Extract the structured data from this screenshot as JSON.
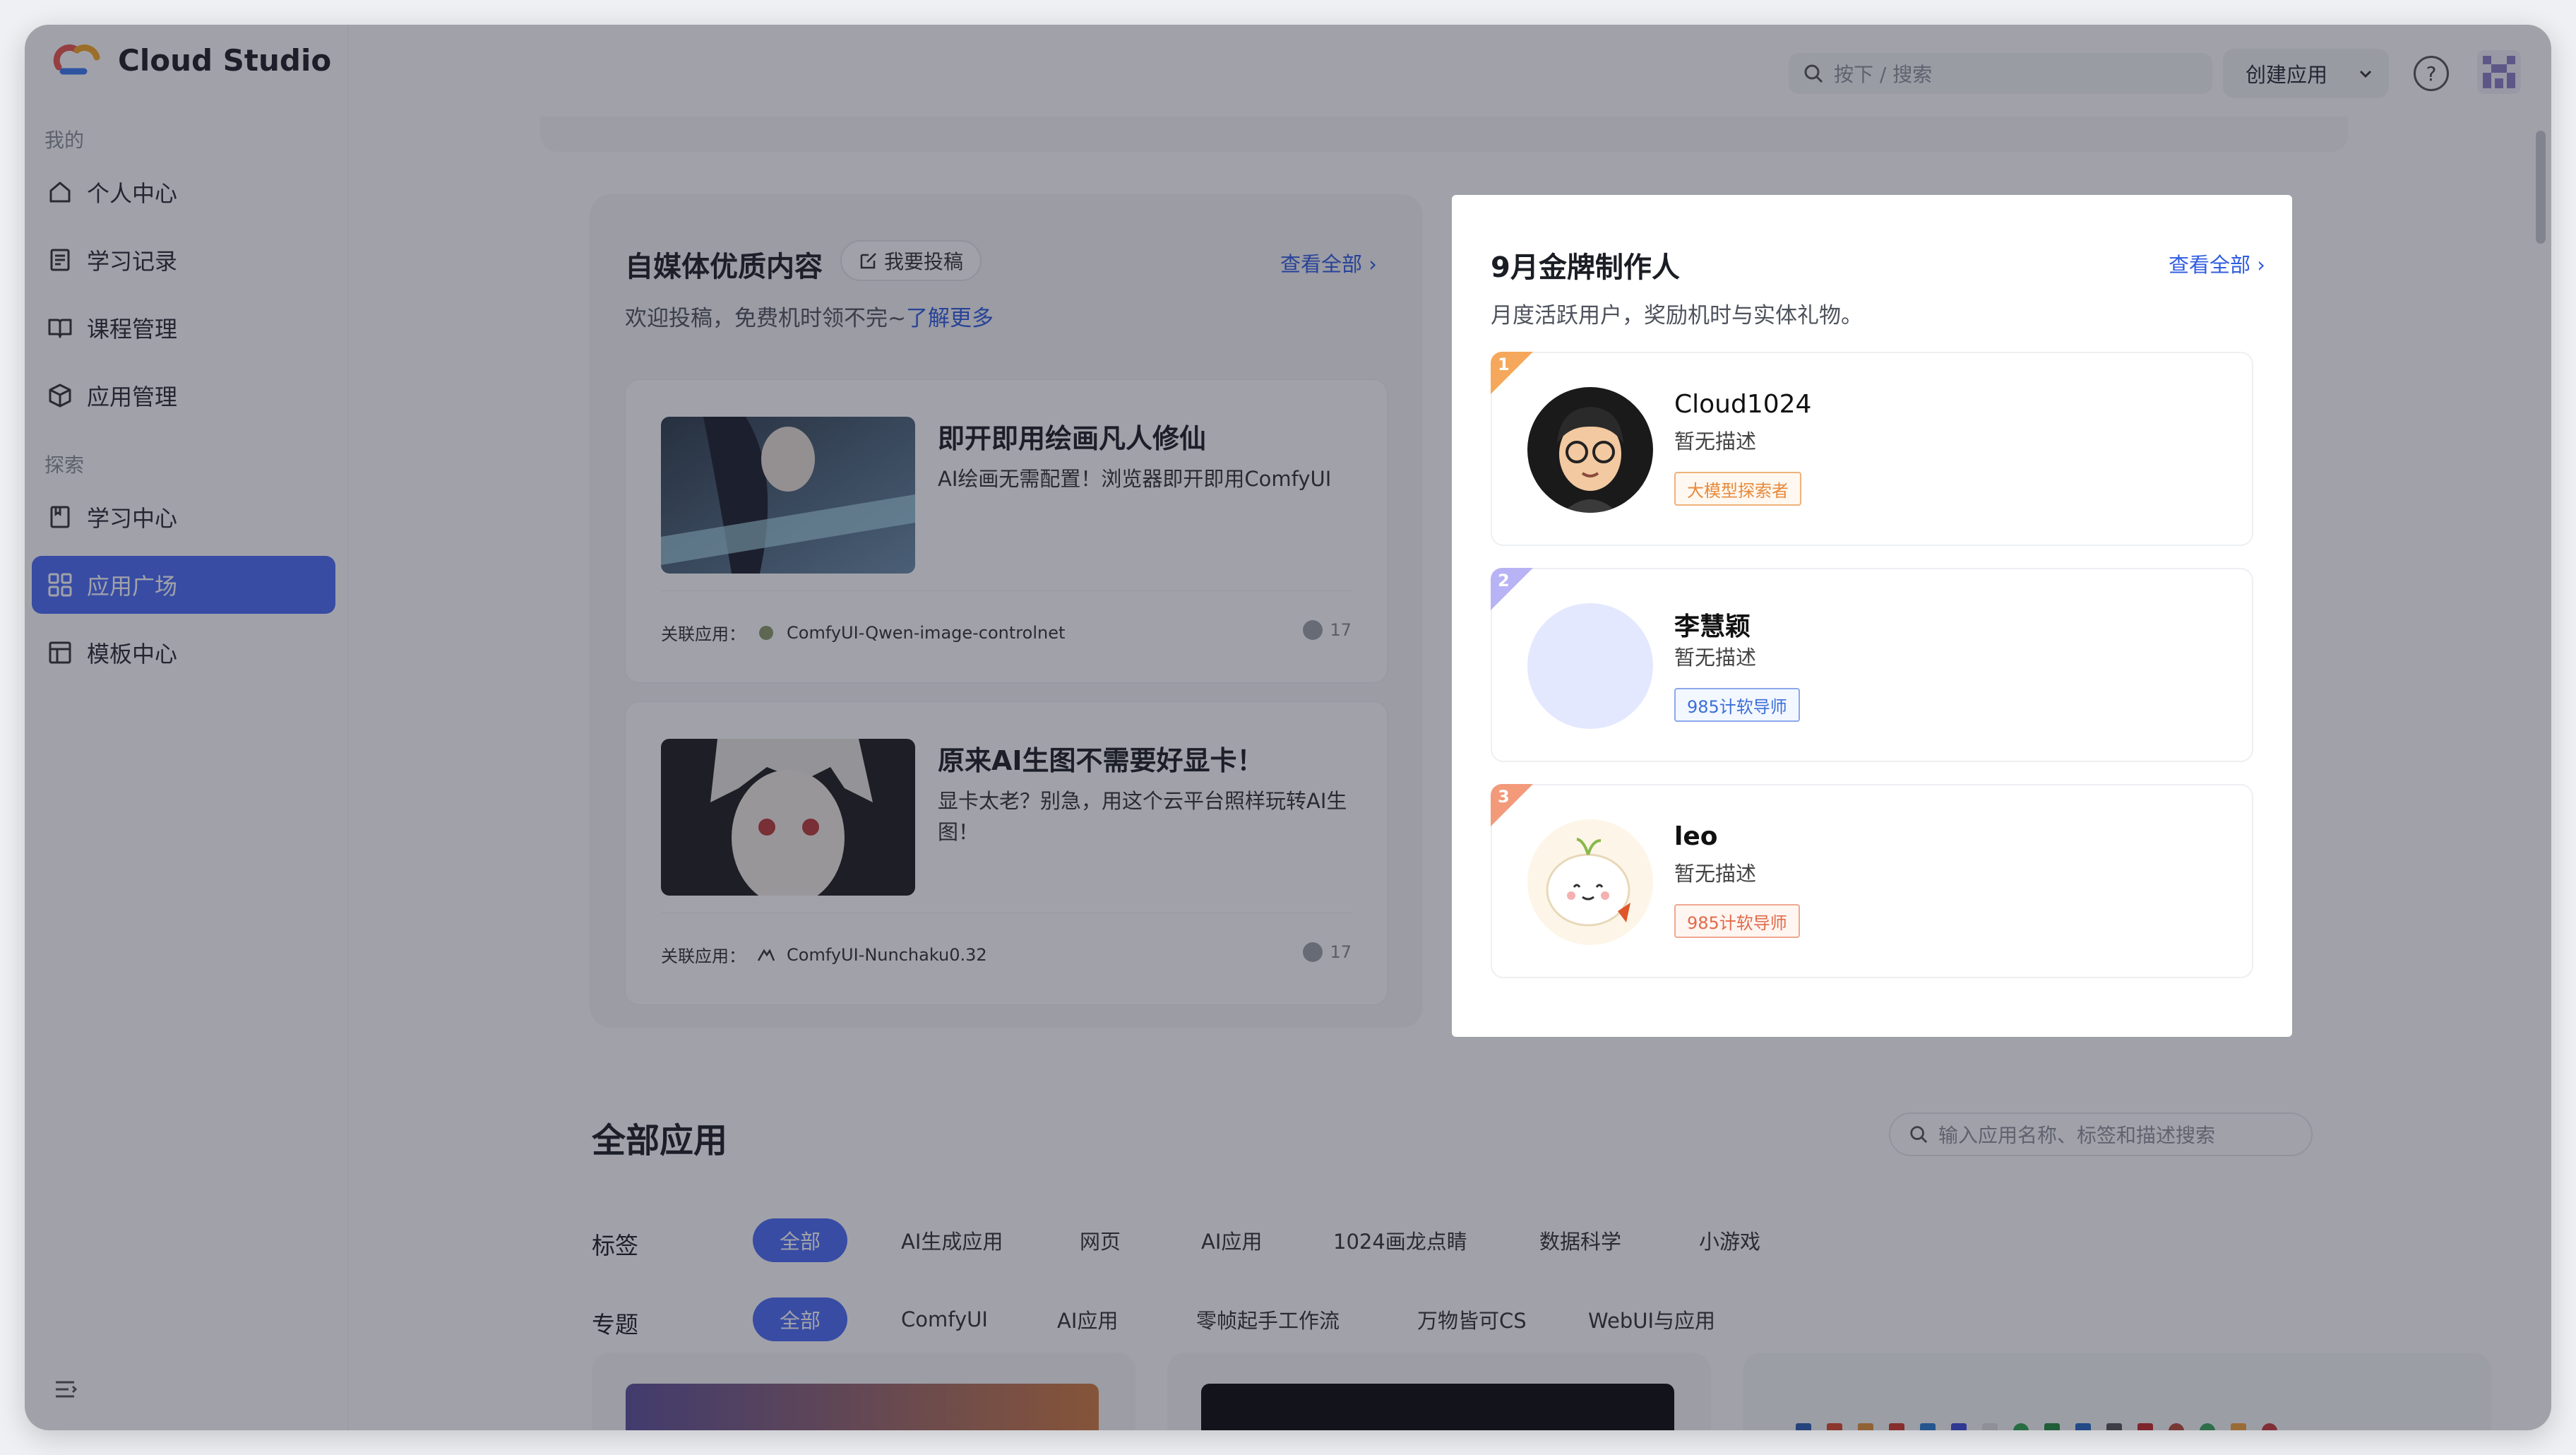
{
  "app": {
    "name": "Cloud Studio"
  },
  "sidebar": {
    "section_mine": "我的",
    "section_explore": "探索",
    "items": [
      {
        "label": "个人中心",
        "icon": "home-icon"
      },
      {
        "label": "学习记录",
        "icon": "record-icon"
      },
      {
        "label": "课程管理",
        "icon": "book-icon"
      },
      {
        "label": "应用管理",
        "icon": "cube-icon"
      },
      {
        "label": "学习中心",
        "icon": "notebook-icon"
      },
      {
        "label": "应用广场",
        "icon": "grid-icon",
        "active": true
      },
      {
        "label": "模板中心",
        "icon": "template-icon"
      }
    ]
  },
  "header": {
    "search_placeholder": "按下 /  搜索",
    "create_label": "创建应用"
  },
  "media_section": {
    "title": "自媒体优质内容",
    "submit_label": "我要投稿",
    "view_all": "查看全部",
    "subtitle": "欢迎投稿，免费机时领不完~",
    "learn_more": "了解更多",
    "posts": [
      {
        "title": "即开即用绘画凡人修仙",
        "desc": "AI绘画无需配置！浏览器即开即用ComfyUI",
        "related_label": "关联应用：",
        "related_app": "ComfyUI-Qwen-image-controlnet",
        "views": "17"
      },
      {
        "title": "原来AI生图不需要好显卡！",
        "desc": "显卡太老？别急，用这个云平台照样玩转AI生图！",
        "related_label": "关联应用：",
        "related_app": "ComfyUI-Nunchaku0.32",
        "views": "17"
      }
    ]
  },
  "gold_creators": {
    "title": "9月金牌制作人",
    "view_all": "查看全部",
    "subtitle": "月度活跃用户，奖励机时与实体礼物。",
    "creators": [
      {
        "rank": "1",
        "name": "Cloud1024",
        "desc": "暂无描述",
        "tag": "大模型探索者",
        "rank_color": "#f5a85b",
        "tag_color": "#e7893a"
      },
      {
        "rank": "2",
        "name": "李慧颖",
        "desc": "暂无描述",
        "tag": "985计软导师",
        "rank_color": "#b8b3f5",
        "tag_color": "#3b6fd8"
      },
      {
        "rank": "3",
        "name": "leo",
        "desc": "暂无描述",
        "tag": "985计软导师",
        "rank_color": "#f29a7a",
        "tag_color": "#e06b4a"
      }
    ]
  },
  "all_apps": {
    "title": "全部应用",
    "search_placeholder": "输入应用名称、标签和描述搜索",
    "tags_label": "标签",
    "tags": [
      "全部",
      "AI生成应用",
      "网页",
      "AI应用",
      "1024画龙点睛",
      "数据科学",
      "小游戏"
    ],
    "topics_label": "专题",
    "topics": [
      "全部",
      "ComfyUI",
      "AI应用",
      "零帧起手工作流",
      "万物皆可CS",
      "WebUI与应用"
    ]
  },
  "colors": {
    "accent": "#4a6cf7",
    "link": "#2f5ce0"
  }
}
